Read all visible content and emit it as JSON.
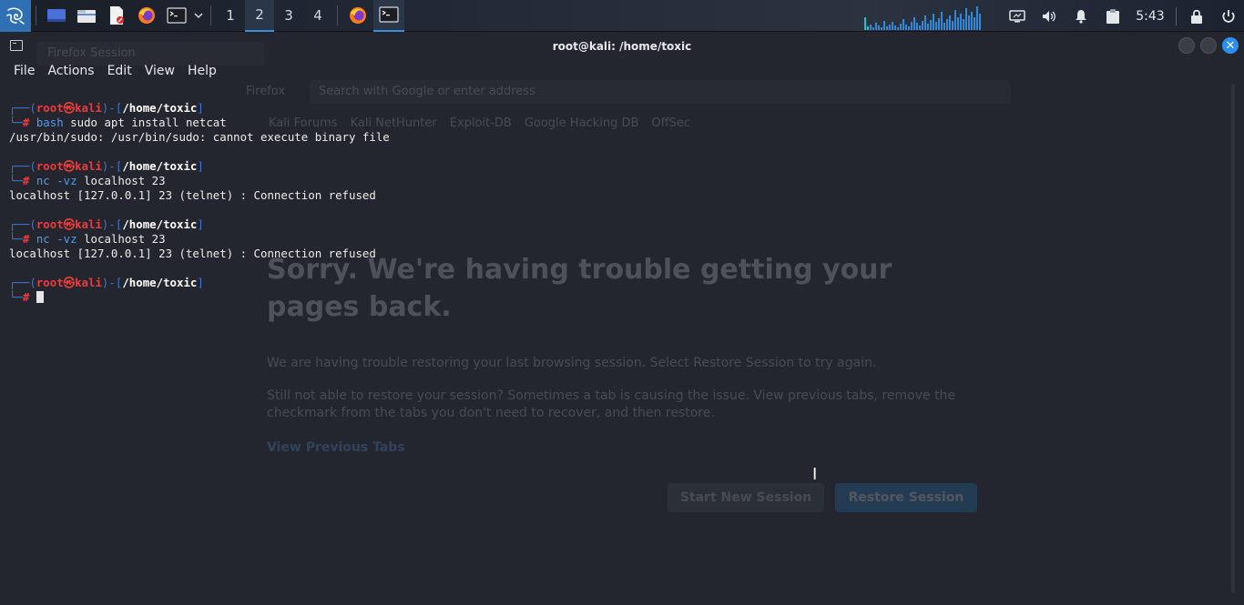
{
  "panel": {
    "workspaces": [
      "1",
      "2",
      "3",
      "4"
    ],
    "active_workspace": "2",
    "clock": "5:43",
    "accent": "#3b8de0"
  },
  "window": {
    "title": "root@kali: /home/toxic"
  },
  "menu": [
    "File",
    "Actions",
    "Edit",
    "View",
    "Help"
  ],
  "terminal": {
    "blocks": [
      {
        "user": "root",
        "host": "kali",
        "dir": "/home/toxic",
        "command": "bash",
        "args": " sudo apt install netcat",
        "output": "/usr/bin/sudo: /usr/bin/sudo: cannot execute binary file"
      },
      {
        "user": "root",
        "host": "kali",
        "dir": "/home/toxic",
        "command": "nc",
        "args": " -vz localhost 23",
        "output": "localhost [127.0.0.1] 23 (telnet) : Connection refused"
      },
      {
        "user": "root",
        "host": "kali",
        "dir": "/home/toxic",
        "command": "nc",
        "args": " -vz localhost 23",
        "output": "localhost [127.0.0.1] 23 (telnet) : Connection refused"
      },
      {
        "user": "root",
        "host": "kali",
        "dir": "/home/toxic",
        "command": "",
        "args": "",
        "output": ""
      }
    ]
  },
  "background_firefox": {
    "tab": "Firefox Session",
    "app_label": "Firefox",
    "url_placeholder": "Search with Google or enter address",
    "bookmarks": [
      "Kali Forums",
      "Kali NetHunter",
      "Exploit-DB",
      "Google Hacking DB",
      "OffSec"
    ],
    "heading": "Sorry. We're having trouble getting your pages back.",
    "para1": "We are having trouble restoring your last browsing session. Select Restore Session to try again.",
    "para2": "Still not able to restore your session? Sometimes a tab is causing the issue. View previous tabs, remove the checkmark from the tabs you don't need to recover, and then restore.",
    "link": "View Previous Tabs",
    "button_new": "Start New Session",
    "button_restore": "Restore Session"
  }
}
